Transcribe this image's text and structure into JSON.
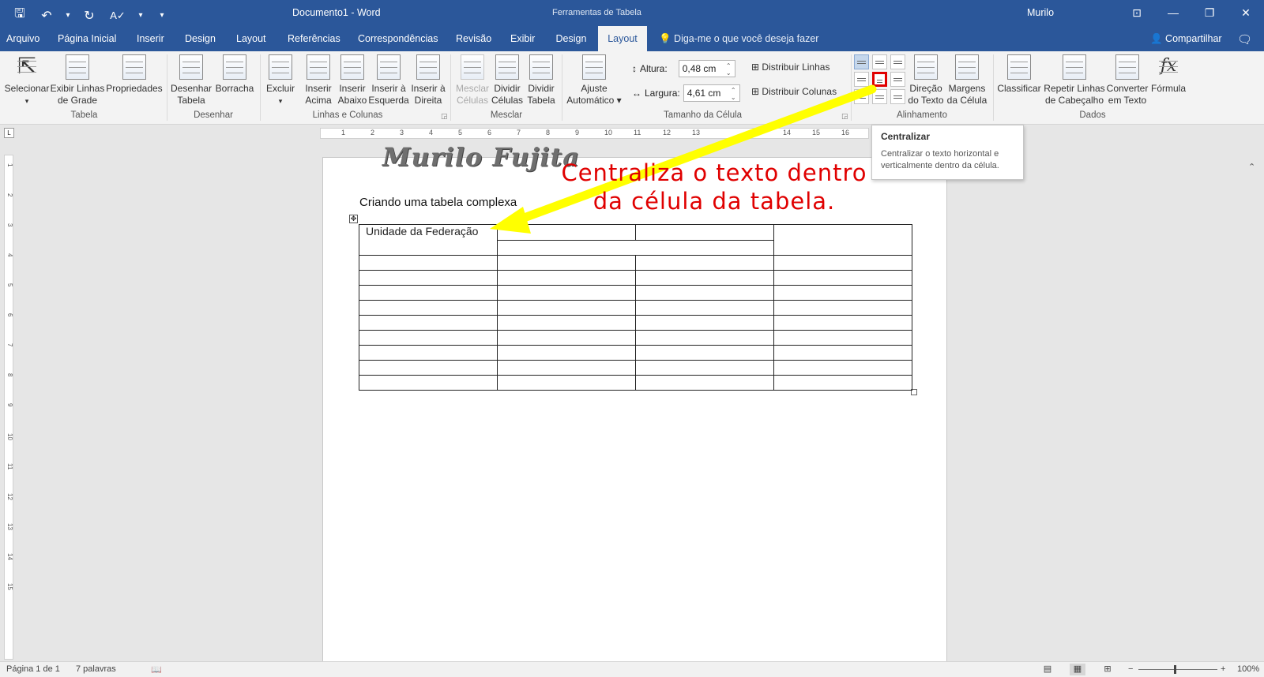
{
  "titlebar": {
    "qat": {
      "save": "🖫",
      "undo": "↶",
      "undo_dropdown": "▾",
      "redo": "↻",
      "spelling": "A✓",
      "spelling_dropdown": "▾",
      "customize": "▾"
    },
    "title": "Documento1  -  Word",
    "context_tools": "Ferramentas de Tabela",
    "user": "Murilo",
    "ribbon_display": "⊡",
    "minimize": "—",
    "restore": "❐",
    "close": "✕"
  },
  "tabs": [
    {
      "label": "Arquivo"
    },
    {
      "label": "Página Inicial"
    },
    {
      "label": "Inserir"
    },
    {
      "label": "Design"
    },
    {
      "label": "Layout"
    },
    {
      "label": "Referências"
    },
    {
      "label": "Correspondências"
    },
    {
      "label": "Revisão"
    },
    {
      "label": "Exibir"
    },
    {
      "label": "Design"
    },
    {
      "label": "Layout"
    }
  ],
  "tellme": "💡 Diga-me o que você deseja fazer",
  "share": "👤 Compartilhar",
  "comment_icon": "🗨",
  "ribbon": {
    "tabela": {
      "group": "Tabela",
      "selecionar": "Selecionar",
      "selecionar_arrow": "▾",
      "exibir_linhas": [
        "Exibir Linhas",
        "de Grade"
      ],
      "propriedades": "Propriedades"
    },
    "desenhar": {
      "group": "Desenhar",
      "desenhar_tabela": [
        "Desenhar",
        "Tabela"
      ],
      "borracha": "Borracha"
    },
    "linhas_colunas": {
      "group": "Linhas e Colunas",
      "excluir": "Excluir",
      "excluir_arrow": "▾",
      "acima": [
        "Inserir",
        "Acima"
      ],
      "abaixo": [
        "Inserir",
        "Abaixo"
      ],
      "esquerda": [
        "Inserir à",
        "Esquerda"
      ],
      "direita": [
        "Inserir à",
        "Direita"
      ],
      "launcher": "◲"
    },
    "mesclar": {
      "group": "Mesclar",
      "mesclar": [
        "Mesclar",
        "Células"
      ],
      "dividir_celulas": [
        "Dividir",
        "Células"
      ],
      "dividir_tabela": [
        "Dividir",
        "Tabela"
      ]
    },
    "tamanho": {
      "group": "Tamanho da Célula",
      "ajuste": [
        "Ajuste",
        "Automático ▾"
      ],
      "altura_label": "Altura:",
      "altura_value": "0,48 cm",
      "largura_label": "Largura:",
      "largura_value": "4,61 cm",
      "distribuir_linhas": "Distribuir Linhas",
      "distribuir_colunas": "Distribuir Colunas",
      "launcher": "◲"
    },
    "alinhamento": {
      "group": "Alinhamento",
      "direcao": [
        "Direção",
        "do Texto"
      ],
      "margens": [
        "Margens",
        "da Célula"
      ]
    },
    "dados": {
      "group": "Dados",
      "classificar": "Classificar",
      "repetir": [
        "Repetir Linhas",
        "de Cabeçalho"
      ],
      "converter": [
        "Converter",
        "em Texto"
      ],
      "formula": "Fórmula"
    },
    "collapse": "⌃"
  },
  "tooltip": {
    "title": "Centralizar",
    "desc1": "Centralizar o texto horizontal e",
    "desc2": "verticalmente dentro da célula."
  },
  "ruler": {
    "corner": "L",
    "h_ticks": [
      "1",
      "2",
      "3",
      "4",
      "5",
      "6",
      "7",
      "8",
      "9",
      "10",
      "11",
      "12",
      "13",
      "14",
      "15",
      "16"
    ],
    "v_ticks": [
      "1",
      "2",
      "3",
      "4",
      "5",
      "6",
      "7",
      "8",
      "9",
      "10",
      "11",
      "12",
      "13",
      "14",
      "15"
    ]
  },
  "document": {
    "header_name": "Murilo Fujita",
    "line1": "Criando uma tabela complexa",
    "table_move_handle": "✥",
    "cell_text": "Unidade da Federação"
  },
  "annotation": {
    "line1": "Centraliza o texto dentro",
    "line2": "da célula da tabela.",
    "arrow_color": "#ffff00",
    "text_color": "#e00000"
  },
  "statusbar": {
    "page": "Página 1 de 1",
    "words": "7 palavras",
    "proofing_icon": "📖",
    "read_mode": "▤",
    "print_layout": "▦",
    "web_layout": "⊞",
    "zoom_minus": "−",
    "zoom_plus": "+",
    "zoom": "100%"
  }
}
